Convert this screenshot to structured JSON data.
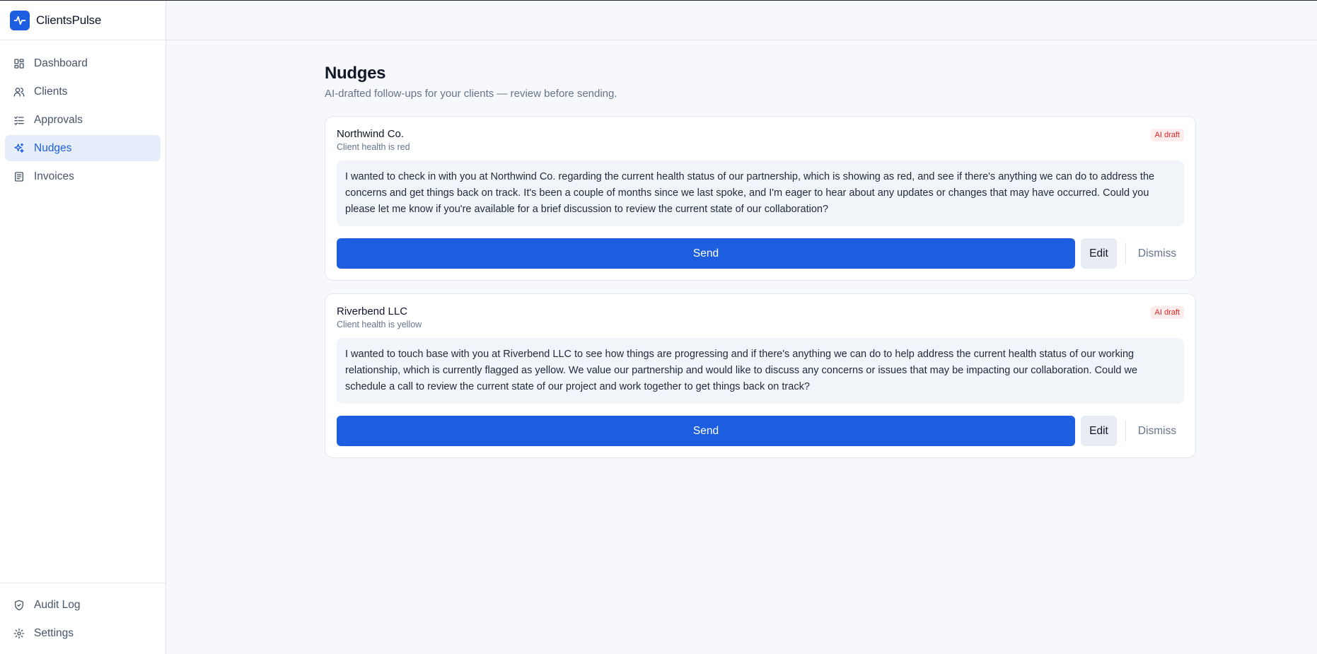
{
  "brand": {
    "name": "ClientsPulse",
    "accent": "#1d5ee0"
  },
  "sidebar": {
    "items": [
      {
        "label": "Dashboard",
        "icon": "dashboard-icon"
      },
      {
        "label": "Clients",
        "icon": "users-icon"
      },
      {
        "label": "Approvals",
        "icon": "checklist-icon"
      },
      {
        "label": "Nudges",
        "icon": "sparkles-icon",
        "active": true
      },
      {
        "label": "Invoices",
        "icon": "invoice-icon"
      }
    ],
    "bottom": [
      {
        "label": "Audit Log",
        "icon": "shield-check-icon"
      },
      {
        "label": "Settings",
        "icon": "gear-icon"
      }
    ]
  },
  "page": {
    "title": "Nudges",
    "subtitle": "AI-drafted follow-ups for your clients — review before sending."
  },
  "nudges": [
    {
      "client": "Northwind Co.",
      "health": "Client health is red",
      "badge": "AI draft",
      "message": "I wanted to check in with you at Northwind Co. regarding the current health status of our partnership, which is showing as red, and see if there's anything we can do to address the concerns and get things back on track. It's been a couple of months since we last spoke, and I'm eager to hear about any updates or changes that may have occurred. Could you please let me know if you're available for a brief discussion to review the current state of our collaboration?",
      "send_label": "Send",
      "edit_label": "Edit",
      "dismiss_label": "Dismiss"
    },
    {
      "client": "Riverbend LLC",
      "health": "Client health is yellow",
      "badge": "AI draft",
      "message": "I wanted to touch base with you at Riverbend LLC to see how things are progressing and if there's anything we can do to help address the current health status of our working relationship, which is currently flagged as yellow. We value our partnership and would like to discuss any concerns or issues that may be impacting our collaboration. Could we schedule a call to review the current state of our project and work together to get things back on track?",
      "send_label": "Send",
      "edit_label": "Edit",
      "dismiss_label": "Dismiss"
    }
  ]
}
